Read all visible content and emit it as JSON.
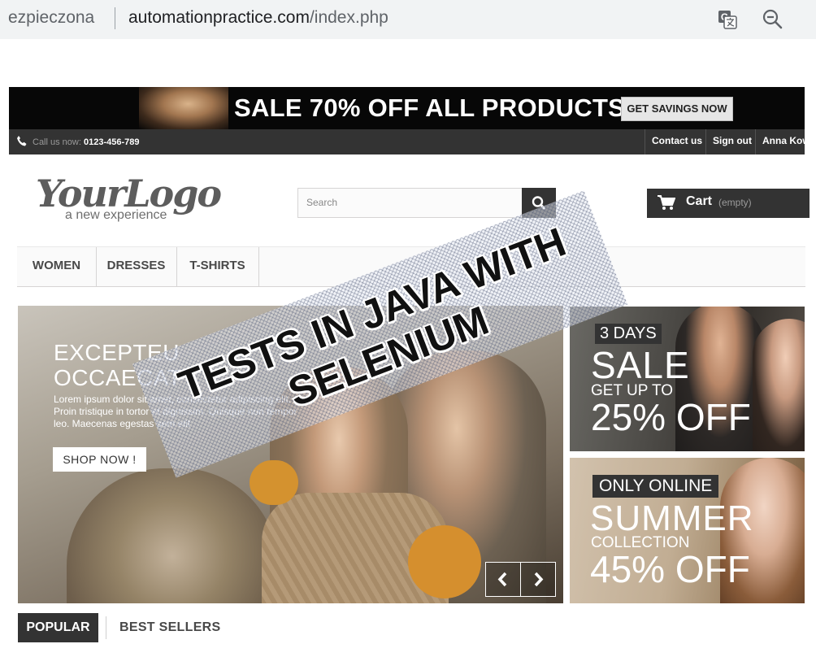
{
  "browser": {
    "security_text": "ezpieczona",
    "url_host": "automationpractice.com",
    "url_path": "/index.php"
  },
  "promo": {
    "headline": "SALE 70% OFF ALL PRODUCTS",
    "cta": "GET SAVINGS NOW"
  },
  "topbar": {
    "call_label": "Call us now:",
    "phone": "0123-456-789",
    "contact": "Contact us",
    "signout": "Sign out",
    "user": "Anna Kow"
  },
  "header": {
    "logo_main": "YourLogo",
    "logo_tagline": "a new experience",
    "search_placeholder": "Search",
    "cart_label": "Cart",
    "cart_status": "(empty)"
  },
  "menu": [
    "WOMEN",
    "DRESSES",
    "T-SHIRTS"
  ],
  "slider": {
    "heading_line1": "EXCEPTEU",
    "heading_line2": "OCCAECAT",
    "description": "Lorem ipsum dolor sit amet, consectetur adipiscing elit. Proin tristique in tortor et dignissim. Quisque non tempor leo. Maecenas egestas sem elit",
    "button": "SHOP NOW !"
  },
  "banner_top": {
    "tag": "3 DAYS",
    "line1": "SALE",
    "line2": "GET UP TO",
    "line3": "25% OFF"
  },
  "banner_bottom": {
    "tag": "ONLY ONLINE",
    "line1": "SUMMER",
    "line2": "COLLECTION",
    "line3": "45% OFF"
  },
  "overlay": {
    "line1": "TESTS IN JAVA WITH",
    "line2": "SELENIUM"
  },
  "tabs": {
    "popular": "POPULAR",
    "best": "BEST SELLERS"
  },
  "colors": {
    "dark": "#333333",
    "promo_bg": "#070707"
  }
}
